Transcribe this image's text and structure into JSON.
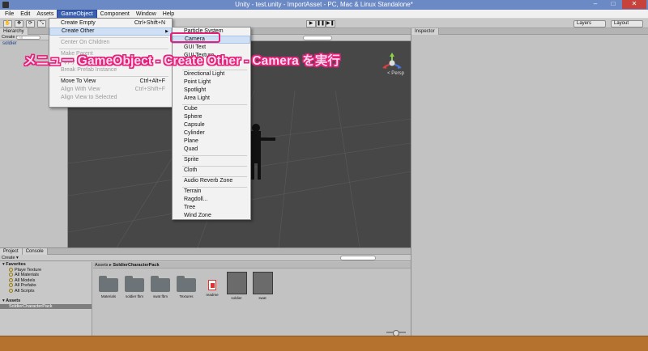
{
  "window": {
    "title": "Unity - test.unity - ImportAsset - PC, Mac & Linux Standalone*",
    "min": "–",
    "max": "□",
    "close": "✕"
  },
  "menubar": [
    "File",
    "Edit",
    "Assets",
    "GameObject",
    "Component",
    "Window",
    "Help"
  ],
  "toolbar": {
    "tools": [
      "✋",
      "✥",
      "⟳",
      "⤡"
    ],
    "play": "▶",
    "pause": "❚❚",
    "step": "▶❚",
    "layers": "Layers",
    "layout": "Layout"
  },
  "hierarchy": {
    "tab": "Hierarchy",
    "create": "Create ▾",
    "search": "All",
    "items": [
      "soldier"
    ]
  },
  "scene": {
    "persp_label": "< Persp"
  },
  "inspector": {
    "tab": "Inspector"
  },
  "gameobject_menu": [
    {
      "label": "Create Empty",
      "shortcut": "Ctrl+Shift+N",
      "disabled": false
    },
    {
      "label": "Create Other",
      "shortcut": "",
      "disabled": false,
      "submenu": true
    },
    {
      "label": "Center On Children",
      "disabled": true
    },
    {
      "label": "Make Parent",
      "disabled": true
    },
    {
      "label": "Apply Changes To Prefab",
      "disabled": true
    },
    {
      "label": "Break Prefab Instance",
      "disabled": true
    },
    {
      "label": "Move To View",
      "shortcut": "Ctrl+Alt+F",
      "disabled": false
    },
    {
      "label": "Align With View",
      "shortcut": "Ctrl+Shift+F",
      "disabled": true
    },
    {
      "label": "Align View to Selected",
      "disabled": true
    }
  ],
  "create_other_menu": [
    "Particle System",
    "Camera",
    "GUI Text",
    "GUI Texture",
    "3D Text",
    "Directional Light",
    "Point Light",
    "Spotlight",
    "Area Light",
    "Cube",
    "Sphere",
    "Capsule",
    "Cylinder",
    "Plane",
    "Quad",
    "Sprite",
    "Cloth",
    "Audio Reverb Zone",
    "Terrain",
    "Ragdoll...",
    "Tree",
    "Wind Zone"
  ],
  "callout": "メニュー GameObject - Create Other - Camera を実行",
  "project": {
    "tabs": [
      "Project",
      "Console"
    ],
    "create": "Create ▾",
    "tree": {
      "favorites": "Favorites",
      "favorite_items": [
        "Playe Texture",
        "All Materials",
        "All Models",
        "All Prefabs",
        "All Scripts"
      ],
      "assets": "Assets",
      "asset_items": [
        "SoldierCharacterPack"
      ]
    },
    "breadcrumb": {
      "root": "Assets",
      "sep": "▸",
      "current": "SoldierCharacterPack"
    },
    "assets": [
      "Materials",
      "soldier fbm",
      "swat fbm",
      "Textures",
      "readme",
      "soldier",
      "swat"
    ]
  },
  "colors": {
    "highlight": "#e2227a",
    "menu_selected": "#cfe0f5",
    "title_bar": "#6b89c4",
    "taskbar": "#b5712e"
  }
}
